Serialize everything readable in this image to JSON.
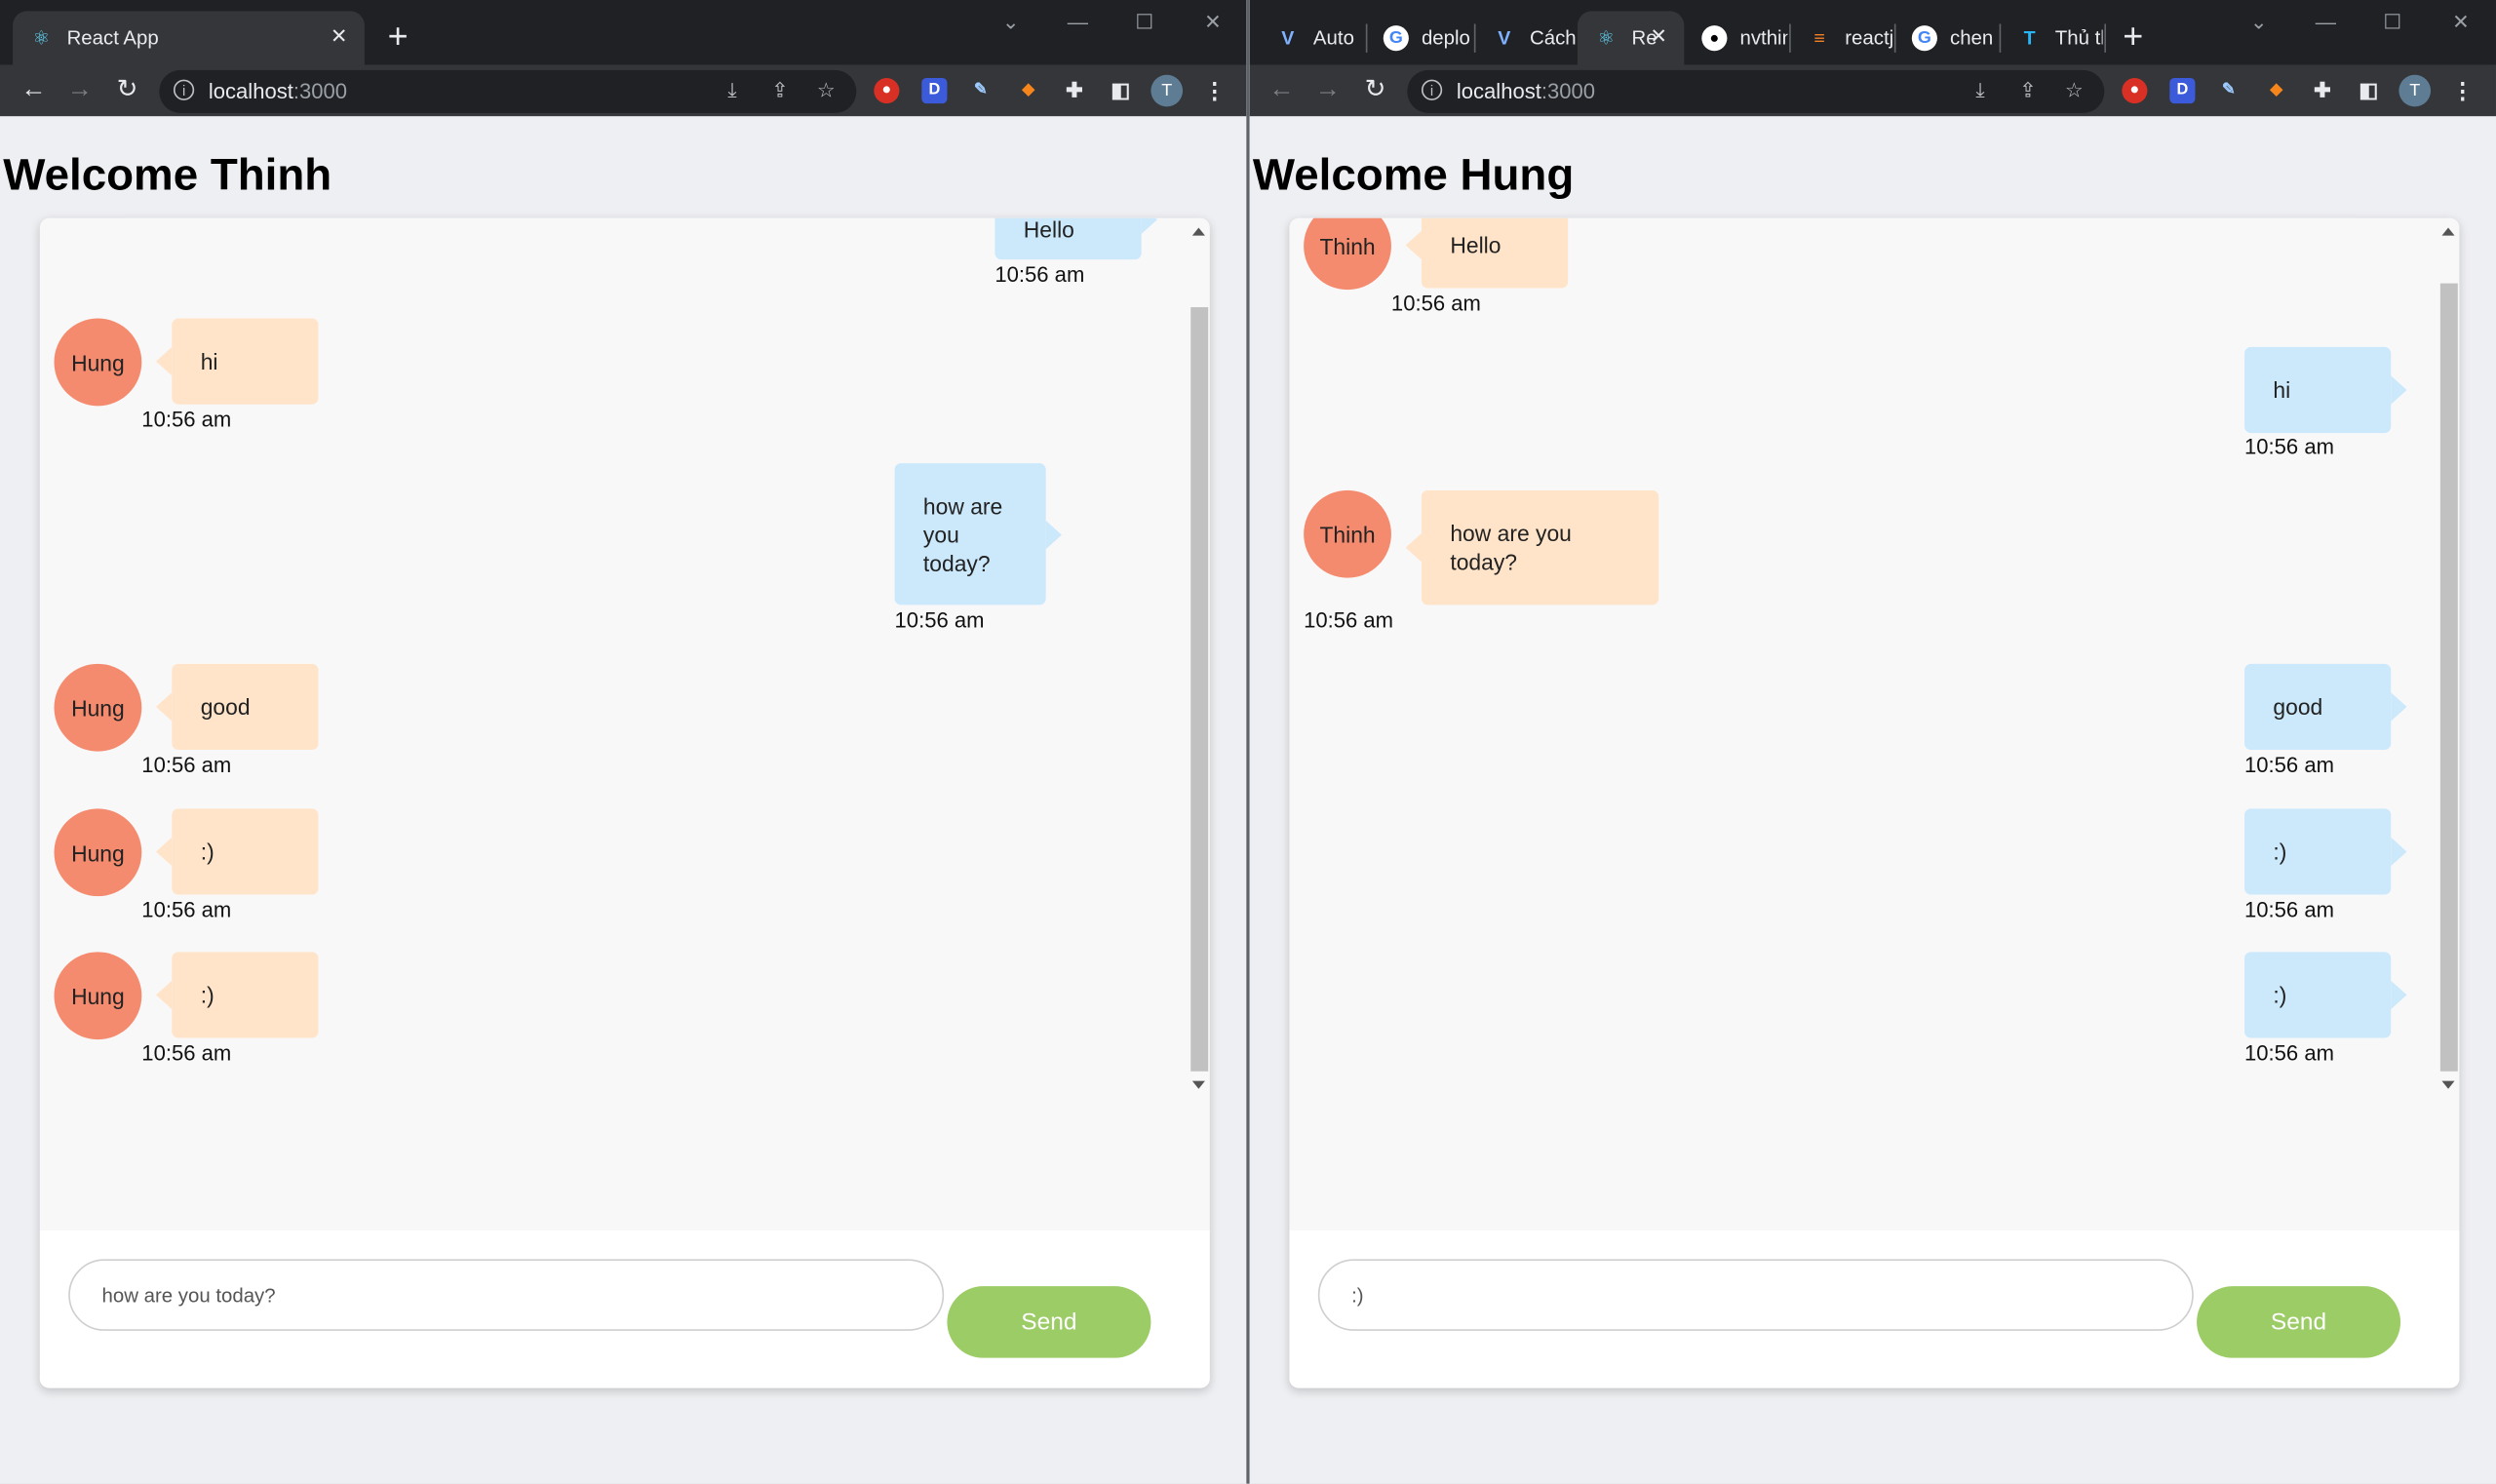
{
  "left": {
    "tabs": [
      {
        "label": "React App",
        "icon": "react-icon",
        "active": true
      }
    ],
    "url": {
      "host": "localhost",
      "port": ":3000"
    },
    "title": "Welcome Thinh",
    "messages": [
      {
        "side": "out",
        "text": "Hello",
        "time": "10:56 am"
      },
      {
        "side": "in",
        "author": "Hung",
        "text": "hi",
        "time": "10:56 am"
      },
      {
        "side": "out",
        "text": "how are you today?",
        "time": "10:56 am"
      },
      {
        "side": "in",
        "author": "Hung",
        "text": "good",
        "time": "10:56 am"
      },
      {
        "side": "in",
        "author": "Hung",
        "text": ":)",
        "time": "10:56 am"
      },
      {
        "side": "in",
        "author": "Hung",
        "text": ":)",
        "time": "10:56 am"
      }
    ],
    "input_value": "how are you today?",
    "send_label": "Send"
  },
  "right": {
    "tabs": [
      {
        "label": "Auto",
        "icon": "vuetify-icon"
      },
      {
        "label": "deplo",
        "icon": "google-icon"
      },
      {
        "label": "Cách",
        "icon": "vuetify-icon"
      },
      {
        "label": "Re",
        "icon": "react-icon",
        "active": true
      },
      {
        "label": "nvthin",
        "icon": "github-icon"
      },
      {
        "label": "reactj",
        "icon": "stackoverflow-icon"
      },
      {
        "label": "chen",
        "icon": "google-icon"
      },
      {
        "label": "Thủ th",
        "icon": "site-icon"
      }
    ],
    "url": {
      "host": "localhost",
      "port": ":3000"
    },
    "title": "Welcome Hung",
    "messages": [
      {
        "side": "in",
        "author": "Thinh",
        "text": "Hello",
        "time": "10:56 am"
      },
      {
        "side": "out",
        "text": "hi",
        "time": "10:56 am"
      },
      {
        "side": "in",
        "author": "Thinh",
        "text": "how are you today?",
        "time": "10:56 am"
      },
      {
        "side": "out",
        "text": "good",
        "time": "10:56 am"
      },
      {
        "side": "out",
        "text": ":)",
        "time": "10:56 am"
      },
      {
        "side": "out",
        "text": ":)",
        "time": "10:56 am"
      }
    ],
    "input_value": ":)",
    "send_label": "Send"
  },
  "profile_initial": "T",
  "colors": {
    "incoming_bubble": "#ffe4c9",
    "outgoing_bubble": "#cce9fc",
    "avatar": "#f58b6e",
    "send_button": "#9ccc65"
  }
}
